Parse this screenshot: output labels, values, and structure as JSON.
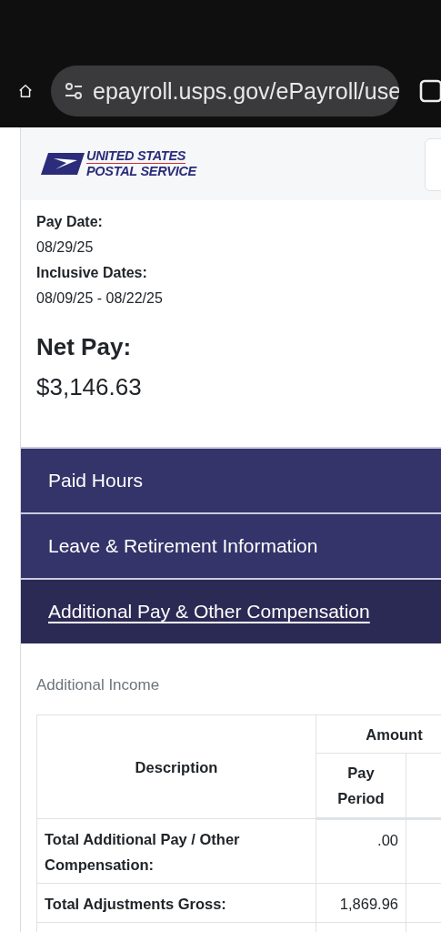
{
  "browser": {
    "url": "epayroll.usps.gov/ePayroll/use"
  },
  "header": {
    "logo_lines": [
      "UNITED STATES",
      "POSTAL SERVICE"
    ]
  },
  "summary": {
    "fields": [
      {
        "label": "Pay Date:",
        "value": "08/29/25"
      },
      {
        "label": "Inclusive Dates:",
        "value": "08/09/25 - 08/22/25"
      }
    ],
    "net_pay_label": "Net Pay:",
    "net_pay": "$3,146.63"
  },
  "sections": [
    {
      "label": "Paid Hours",
      "selected": false
    },
    {
      "label": "Leave & Retirement Information",
      "selected": false
    },
    {
      "label": "Additional Pay & Other Compensation",
      "selected": true
    }
  ],
  "income": {
    "title": "Additional Income",
    "columns": {
      "description": "Description",
      "group": "Amount",
      "pay_period": "Pay Period"
    },
    "rows": [
      {
        "description": "Total Additional Pay / Other Compensation:",
        "pay_period": ".00"
      },
      {
        "description": "Total Adjustments Gross:",
        "pay_period": "1,869.96"
      }
    ]
  }
}
